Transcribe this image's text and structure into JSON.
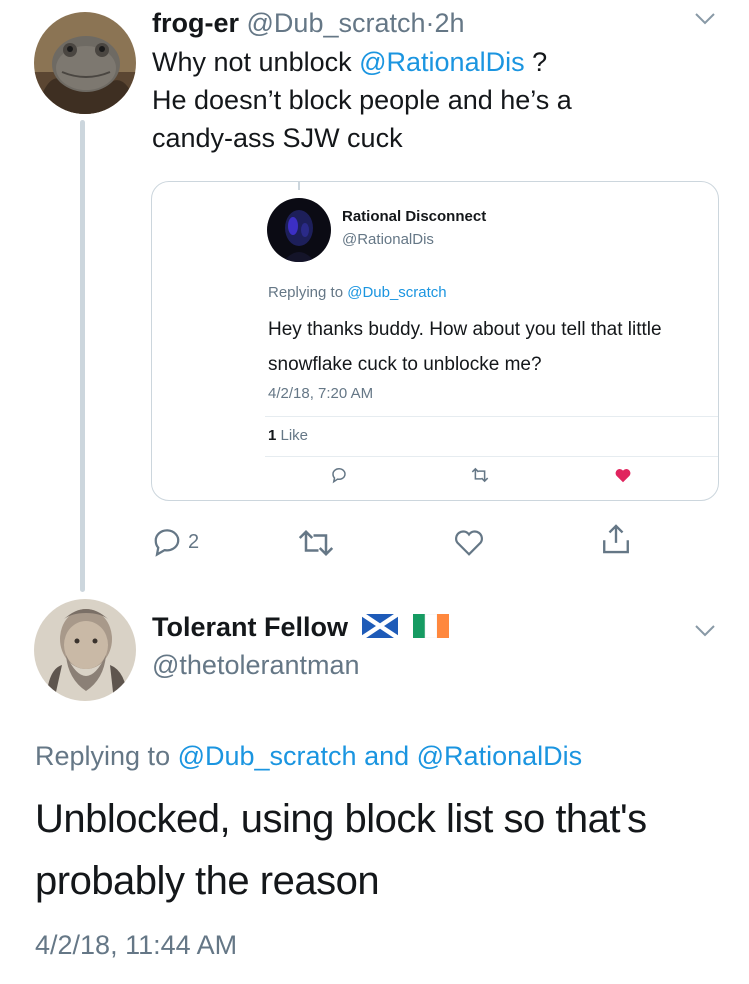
{
  "tweet1": {
    "display_name": "frog-er",
    "handle": "@Dub_scratch",
    "separator": "·",
    "time": "2h",
    "text_line1_prefix": "Why not unblock ",
    "text_line1_mention": "@RationalDis",
    "text_line1_suffix": " ?",
    "text_line2": "He doesn’t block people and he’s a",
    "text_line3": "candy-ass SJW cuck",
    "reply_count": "2",
    "avatar_icon": "frog-avatar",
    "menu_icon": "chevron-down-icon"
  },
  "quoted": {
    "display_name": "Rational Disconnect",
    "handle": "@RationalDis",
    "replying_prefix": "Replying to ",
    "replying_mention": "@Dub_scratch",
    "text_line1": "Hey thanks buddy. How about you tell that little",
    "text_line2": "snowflake cuck to unblocke me?",
    "date": "4/2/18, 7:20 AM",
    "like_count": "1",
    "like_label": " Like",
    "heart_color": "#e0245e"
  },
  "tweet2": {
    "display_name": "Tolerant Fellow",
    "flags": [
      "scotland-flag-icon",
      "ireland-flag-icon"
    ],
    "handle": "@thetolerantman",
    "replying_prefix": "Replying to ",
    "replying_mention1": "@Dub_scratch",
    "replying_and": " and ",
    "replying_mention2": "@RationalDis",
    "text_line1": "Unblocked, using block list so that's",
    "text_line2": "probably the reason",
    "date": "4/2/18, 11:44 AM"
  },
  "colors": {
    "link_blue": "#1b95e0",
    "secondary_grey": "#657786",
    "border_grey": "#ccd6dd"
  }
}
